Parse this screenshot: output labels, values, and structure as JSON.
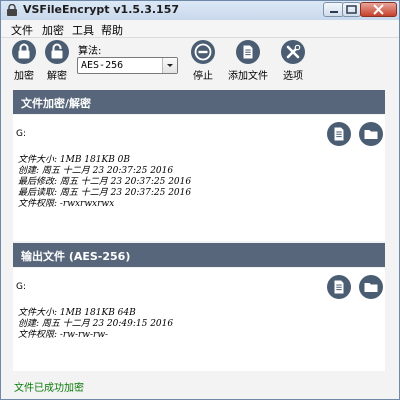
{
  "window": {
    "title": "VSFileEncrypt v1.5.3.157",
    "controls": [
      "minimize",
      "maximize",
      "close"
    ]
  },
  "menu": [
    "文件",
    "加密",
    "工具",
    "帮助"
  ],
  "toolbar": {
    "encrypt": {
      "label": "加密",
      "icon": "lock-icon"
    },
    "decrypt": {
      "label": "解密",
      "icon": "unlock-icon"
    },
    "algorithm": {
      "label": "算法:",
      "value": "AES-256"
    },
    "stop": {
      "label": "停止",
      "icon": "stop-icon"
    },
    "add_file": {
      "label": "添加文件",
      "icon": "document-icon"
    },
    "options": {
      "label": "选项",
      "icon": "tools-icon"
    }
  },
  "input_section": {
    "title": "文件加密/解密",
    "path": "G:",
    "info": [
      "文件大小: 1MB 181KB 0B",
      "创建: 周五 十二月 23 20:37:25 2016",
      "最后修改: 周五 十二月 23 20:37:25 2016",
      "最后读取: 周五 十二月 23 20:37:25 2016",
      "文件权限: -rwxrwxrwx"
    ]
  },
  "output_section": {
    "title": "输出文件 (AES-256)",
    "path": "G:",
    "info": [
      "文件大小: 1MB 181KB 64B",
      "创建: 周五 十二月 23 20:49:15 2016",
      "文件权限: -rw-rw-rw-"
    ]
  },
  "status": {
    "text": "文件已成功加密",
    "color": "#0a7a0a"
  },
  "colors": {
    "section_header": "#57667a",
    "icon_circle": "#4a5d72"
  }
}
